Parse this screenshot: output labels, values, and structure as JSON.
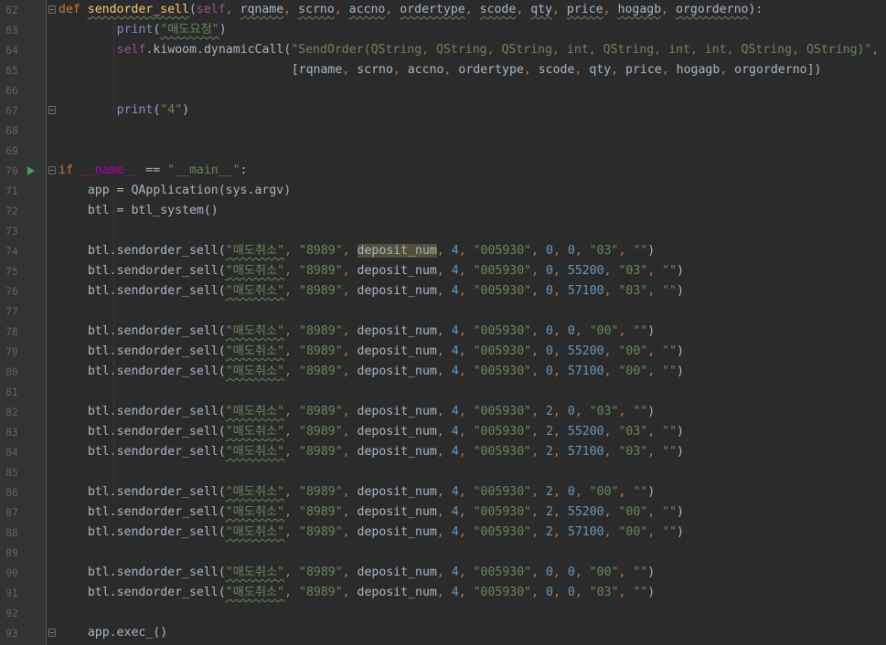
{
  "editor": {
    "lines": [
      {
        "num": "62",
        "type": "def",
        "fold": true,
        "parts": [
          [
            "kw",
            "def "
          ],
          [
            "fn",
            "sendorder_sell"
          ],
          [
            "plain",
            "("
          ],
          [
            "self",
            "self"
          ],
          [
            "kw",
            ", "
          ],
          [
            "plain",
            "rqname"
          ],
          [
            "kw",
            ", "
          ],
          [
            "plain",
            "scrno"
          ],
          [
            "kw",
            ", "
          ],
          [
            "plain",
            "accno"
          ],
          [
            "kw",
            ", "
          ],
          [
            "plain",
            "ordertype"
          ],
          [
            "kw",
            ", "
          ],
          [
            "plain",
            "scode"
          ],
          [
            "kw",
            ", "
          ],
          [
            "plain",
            "qty"
          ],
          [
            "kw",
            ", "
          ],
          [
            "plain",
            "price"
          ],
          [
            "kw",
            ", "
          ],
          [
            "plain",
            "hogagb"
          ],
          [
            "kw",
            ", "
          ],
          [
            "plain",
            "orgorderno"
          ],
          [
            "plain",
            "):"
          ]
        ]
      },
      {
        "num": "63",
        "parts": [
          [
            "bi",
            "print"
          ],
          [
            "plain",
            "("
          ],
          [
            "str",
            "\"매도요청\""
          ],
          [
            "plain",
            ")"
          ]
        ],
        "indent": 8
      },
      {
        "num": "64",
        "parts": [
          [
            "self",
            "self"
          ],
          [
            "plain",
            ".kiwoom.dynamicCall("
          ],
          [
            "str",
            "\"SendOrder(QString, QString, QString, int, QString, int, int, QString, QString)\""
          ],
          [
            "kw",
            ","
          ]
        ],
        "indent": 8
      },
      {
        "num": "65",
        "parts": [
          [
            "plain",
            "[rqname"
          ],
          [
            "kw",
            ", "
          ],
          [
            "plain",
            "scrno"
          ],
          [
            "kw",
            ", "
          ],
          [
            "plain",
            "accno"
          ],
          [
            "kw",
            ", "
          ],
          [
            "plain",
            "ordertype"
          ],
          [
            "kw",
            ", "
          ],
          [
            "plain",
            "scode"
          ],
          [
            "kw",
            ", "
          ],
          [
            "plain",
            "qty"
          ],
          [
            "kw",
            ", "
          ],
          [
            "plain",
            "price"
          ],
          [
            "kw",
            ", "
          ],
          [
            "plain",
            "hogagb"
          ],
          [
            "kw",
            ", "
          ],
          [
            "plain",
            "orgorderno])"
          ]
        ],
        "indent": 32
      },
      {
        "num": "66",
        "parts": []
      },
      {
        "num": "67",
        "fold": true,
        "parts": [
          [
            "bi",
            "print"
          ],
          [
            "plain",
            "("
          ],
          [
            "str",
            "\"4\""
          ],
          [
            "plain",
            ")"
          ]
        ],
        "indent": 8
      },
      {
        "num": "68",
        "parts": []
      },
      {
        "num": "69",
        "parts": []
      },
      {
        "num": "70",
        "run": true,
        "fold": true,
        "parts": [
          [
            "kw",
            "if "
          ],
          [
            "magic",
            "__name__"
          ],
          [
            "plain",
            " == "
          ],
          [
            "str",
            "\"__main__\""
          ],
          [
            "plain",
            ":"
          ]
        ],
        "indent": 0
      },
      {
        "num": "71",
        "parts": [
          [
            "plain",
            "app = QApplication(sys.argv)"
          ]
        ],
        "indent": 4
      },
      {
        "num": "72",
        "parts": [
          [
            "plain",
            "btl = btl_system()"
          ]
        ],
        "indent": 4
      },
      {
        "num": "73",
        "parts": []
      },
      {
        "num": "74",
        "call": [
          "0",
          "0",
          "03"
        ],
        "hl": true
      },
      {
        "num": "75",
        "call": [
          "0",
          "55200",
          "03"
        ]
      },
      {
        "num": "76",
        "call": [
          "0",
          "57100",
          "03"
        ]
      },
      {
        "num": "77",
        "parts": []
      },
      {
        "num": "78",
        "call": [
          "0",
          "0",
          "00"
        ]
      },
      {
        "num": "79",
        "call": [
          "0",
          "55200",
          "00"
        ]
      },
      {
        "num": "80",
        "call": [
          "0",
          "57100",
          "00"
        ]
      },
      {
        "num": "81",
        "parts": []
      },
      {
        "num": "82",
        "call": [
          "2",
          "0",
          "03"
        ]
      },
      {
        "num": "83",
        "call": [
          "2",
          "55200",
          "03"
        ]
      },
      {
        "num": "84",
        "call": [
          "2",
          "57100",
          "03"
        ]
      },
      {
        "num": "85",
        "parts": []
      },
      {
        "num": "86",
        "call": [
          "2",
          "0",
          "00"
        ]
      },
      {
        "num": "87",
        "call": [
          "2",
          "55200",
          "00"
        ]
      },
      {
        "num": "88",
        "call": [
          "2",
          "57100",
          "00"
        ]
      },
      {
        "num": "89",
        "parts": []
      },
      {
        "num": "90",
        "call": [
          "0",
          "0",
          "00"
        ]
      },
      {
        "num": "91",
        "call": [
          "0",
          "0",
          "03"
        ]
      },
      {
        "num": "92",
        "parts": []
      },
      {
        "num": "93",
        "fold": true,
        "parts": [
          [
            "plain",
            "app.exec_()"
          ]
        ],
        "indent": 4
      }
    ],
    "call_template": {
      "prefix": "btl.sendorder_sell(",
      "rqname": "\"매도취소\"",
      "scrno": "\"8989\"",
      "accno": "deposit_num",
      "ordertype": "4",
      "scode": "\"005930\"",
      "orgorderno": "\"\""
    }
  },
  "colors": {
    "background": "#2b2b2b",
    "gutter": "#313335",
    "keyword": "#cc7832",
    "function": "#ffc66d",
    "string": "#6a8759",
    "number": "#6897bb",
    "self": "#94558d",
    "identifier_highlight": "#52503a"
  }
}
